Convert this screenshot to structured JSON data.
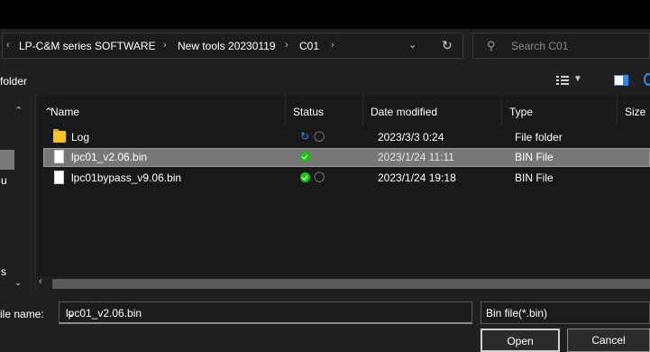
{
  "address": {
    "prefix_chevron": "‹",
    "crumbs": [
      "LP-C&M series SOFTWARE",
      "New tools 20230119",
      "C01"
    ],
    "separator": "›",
    "dropdown_icon": "chevron-down-icon",
    "refresh_icon": "refresh-icon"
  },
  "search": {
    "placeholder": "Search C01",
    "icon": "search-icon"
  },
  "toolbar": {
    "new_folder_label": "folder"
  },
  "nav": {
    "item_u": "u",
    "item_s": "s"
  },
  "columns": {
    "name": "Name",
    "status": "Status",
    "date": "Date modified",
    "type": "Type",
    "size": "Size"
  },
  "files": [
    {
      "name": "Log",
      "icon": "folder-icon",
      "status": "sync",
      "date": "2023/3/3 0:24",
      "type": "File folder",
      "selected": false
    },
    {
      "name": "lpc01_v2.06.bin",
      "icon": "file-icon",
      "status": "available",
      "date": "2023/1/24 11:11",
      "type": "BIN File",
      "selected": true
    },
    {
      "name": "lpc01bypass_v9.06.bin",
      "icon": "file-icon",
      "status": "available-shared",
      "date": "2023/1/24 19:18",
      "type": "BIN File",
      "selected": false
    }
  ],
  "bottom": {
    "file_name_label": "ile name:",
    "file_name_value": "lpc01_v2.06.bin",
    "file_type_value": "Bin file(*.bin)",
    "open_label": "Open",
    "cancel_label": "Cancel"
  },
  "colors": {
    "background": "#202020",
    "selection": "#777777",
    "accent": "#2d89ef",
    "status_ok": "#16c60c",
    "folder": "#f5c518"
  }
}
